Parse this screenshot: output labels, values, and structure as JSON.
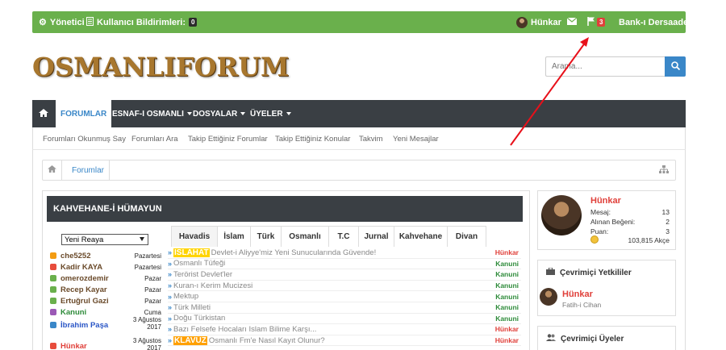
{
  "topbar": {
    "admin_label": "Yönetici",
    "notifications_label": "Kullanıcı Bildirimleri:",
    "notifications_count": "0",
    "user_name": "Hünkar",
    "flag_count": "3",
    "site_name": "Bank-ı Dersaadet"
  },
  "logo": {
    "text": "OSMANLIFORUM"
  },
  "search": {
    "placeholder": "Arama..."
  },
  "nav": {
    "tabs": [
      {
        "label": "FORUMLAR"
      },
      {
        "label": "ESNAF-I OSMANLI"
      },
      {
        "label": "DOSYALAR"
      },
      {
        "label": "ÜYELER"
      }
    ]
  },
  "subnav": {
    "links": [
      {
        "label": "Forumları Okunmuş Say"
      },
      {
        "label": "Forumları Ara"
      },
      {
        "label": "Takip Ettiğiniz Forumlar"
      },
      {
        "label": "Takip Ettiğiniz Konular"
      },
      {
        "label": "Takvim"
      },
      {
        "label": "Yeni Mesajlar"
      }
    ]
  },
  "breadcrumb": {
    "item": "Forumlar"
  },
  "panel": {
    "title": "KAHVEHANE-İ HÜMAYUN"
  },
  "selector": {
    "value": "Yeni Reaya"
  },
  "users": [
    {
      "name": "che5252",
      "date": "Pazartesi",
      "color": "#6a4a2a",
      "icon": "#f39c12"
    },
    {
      "name": "Kadir KAYA",
      "date": "Pazartesi",
      "color": "#6a4a2a",
      "icon": "#e74c3c"
    },
    {
      "name": "omerozdemir",
      "date": "Pazar",
      "color": "#6a4a2a",
      "icon": "#6ab04c"
    },
    {
      "name": "Recep Kayar",
      "date": "Pazar",
      "color": "#6a4a2a",
      "icon": "#6ab04c"
    },
    {
      "name": "Ertuğrul Gazi",
      "date": "Pazar",
      "color": "#6a4a2a",
      "icon": "#6ab04c"
    },
    {
      "name": "Kanuni",
      "date": "Cuma",
      "color": "#2e8b3a",
      "icon": "#9b59b6"
    },
    {
      "name": "İbrahim Paşa",
      "date": "3 Ağustos 2017",
      "color": "#2a56c6",
      "icon": "#3a87c8"
    },
    {
      "name": "Hünkar",
      "date": "3 Ağustos 2017",
      "color": "#e0403a",
      "icon": "#e74c3c"
    }
  ],
  "tabs": [
    {
      "label": "Havadis"
    },
    {
      "label": "İslam"
    },
    {
      "label": "Türk"
    },
    {
      "label": "Osmanlı"
    },
    {
      "label": "T.C"
    },
    {
      "label": "Jurnal"
    },
    {
      "label": "Kahvehane"
    },
    {
      "label": "Divan"
    }
  ],
  "topics": [
    {
      "tag": "ISLAHAT",
      "tag_bg": "#ffd400",
      "tag_fg": "#ffffff",
      "title": "Devlet-i Aliyye'miz Yeni Sunucularında Güvende!",
      "author": "Hünkar",
      "author_color": "#e0403a"
    },
    {
      "tag": "",
      "title": "Osmanlı Tüfeği",
      "author": "Kanuni",
      "author_color": "#2e8b3a"
    },
    {
      "tag": "",
      "title": "Terörist Devlet'ler",
      "author": "Kanuni",
      "author_color": "#2e8b3a"
    },
    {
      "tag": "",
      "title": "Kuran-ı Kerim Mucizesi",
      "author": "Kanuni",
      "author_color": "#2e8b3a"
    },
    {
      "tag": "",
      "title": "Mektup",
      "author": "Kanuni",
      "author_color": "#2e8b3a"
    },
    {
      "tag": "",
      "title": "Türk Milleti",
      "author": "Kanuni",
      "author_color": "#2e8b3a"
    },
    {
      "tag": "",
      "title": "Doğu Türkistan",
      "author": "Kanuni",
      "author_color": "#2e8b3a"
    },
    {
      "tag": "",
      "title": "Bazı Felsefe Hocaları Islam Bilime Karşı...",
      "author": "Hünkar",
      "author_color": "#e0403a"
    },
    {
      "tag": "KLAVUZ",
      "tag_bg": "#ffa000",
      "tag_fg": "#ffffff",
      "title": "Osmanlı Fm'e Nasıl Kayıt Olunur?",
      "author": "Hünkar",
      "author_color": "#e0403a"
    }
  ],
  "profile": {
    "name": "Hünkar",
    "stats": [
      {
        "label": "Mesaj:",
        "value": "13"
      },
      {
        "label": "Alınan Beğeni:",
        "value": "2"
      },
      {
        "label": "Puan:",
        "value": "3"
      }
    ],
    "coins": "103,815 Akçe"
  },
  "online_staff": {
    "title": "Çevrimiçi Yetkililer",
    "member_name": "Hünkar",
    "member_title": "Fatih-i Cihan"
  },
  "online_members": {
    "title": "Çevrimiçi Üyeler"
  }
}
